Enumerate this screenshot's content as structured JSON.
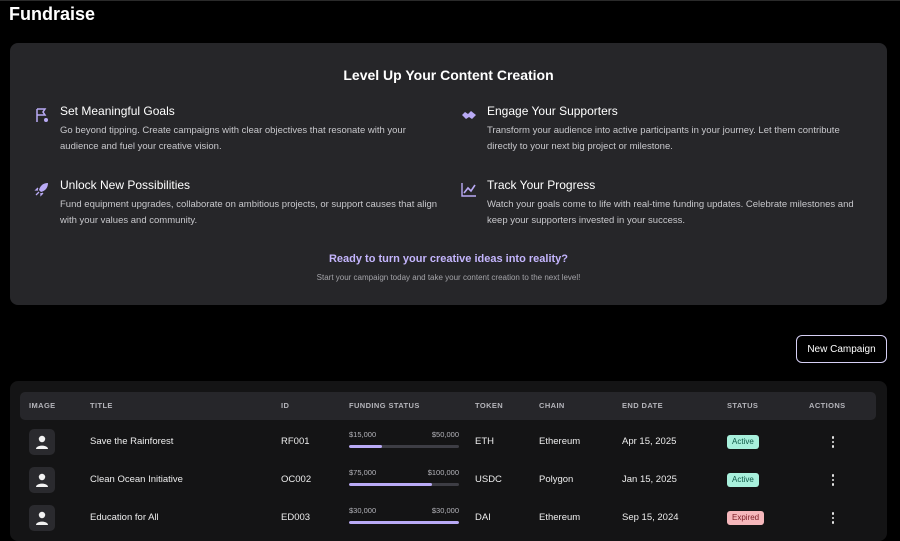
{
  "page": {
    "title": "Fundraise"
  },
  "promo": {
    "title": "Level Up Your Content Creation",
    "features": [
      {
        "icon": "goal-flag-icon",
        "title": "Set Meaningful Goals",
        "description": "Go beyond tipping. Create campaigns with clear objectives that resonate with your audience and fuel your creative vision."
      },
      {
        "icon": "handshake-icon",
        "title": "Engage Your Supporters",
        "description": "Transform your audience into active participants in your journey. Let them contribute directly to your next big project or milestone."
      },
      {
        "icon": "rocket-icon",
        "title": "Unlock New Possibilities",
        "description": "Fund equipment upgrades, collaborate on ambitious projects, or support causes that align with your values and community."
      },
      {
        "icon": "trend-chart-icon",
        "title": "Track Your Progress",
        "description": "Watch your goals come to life with real-time funding updates. Celebrate milestones and keep your supporters invested in your success."
      }
    ],
    "cta_title": "Ready to turn your creative ideas into reality?",
    "cta_subtitle": "Start your campaign today and take your content creation to the next level!"
  },
  "actions": {
    "new_campaign_label": "New Campaign"
  },
  "table": {
    "headers": [
      "IMAGE",
      "TITLE",
      "ID",
      "FUNDING STATUS",
      "TOKEN",
      "CHAIN",
      "END DATE",
      "STATUS",
      "ACTIONS"
    ],
    "rows": [
      {
        "title": "Save the Rainforest",
        "id": "RF001",
        "raised": "$15,000",
        "goal": "$50,000",
        "progress": 0.3,
        "token": "ETH",
        "chain": "Ethereum",
        "end_date": "Apr 15, 2025",
        "status": "Active"
      },
      {
        "title": "Clean Ocean Initiative",
        "id": "OC002",
        "raised": "$75,000",
        "goal": "$100,000",
        "progress": 0.75,
        "token": "USDC",
        "chain": "Polygon",
        "end_date": "Jan 15, 2025",
        "status": "Active"
      },
      {
        "title": "Education for All",
        "id": "ED003",
        "raised": "$30,000",
        "goal": "$30,000",
        "progress": 1.0,
        "token": "DAI",
        "chain": "Ethereum",
        "end_date": "Sep 15, 2024",
        "status": "Expired"
      }
    ]
  },
  "colors": {
    "accent": "#c4b5fd",
    "progress_fill": "#b9aaf5",
    "active_badge": "#a8f0dc",
    "expired_badge": "#f5b7bb"
  }
}
